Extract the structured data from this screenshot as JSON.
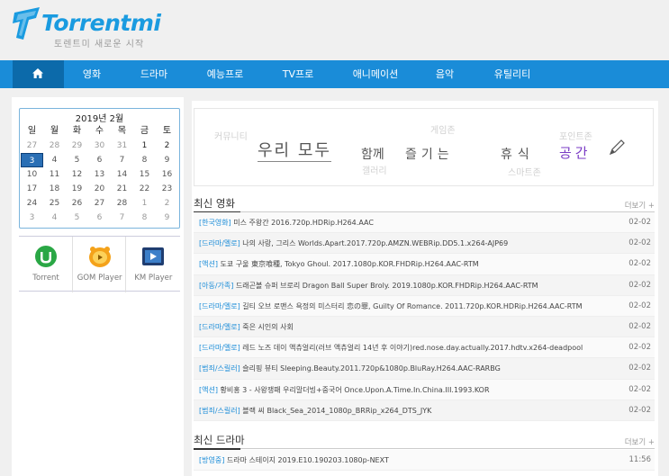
{
  "site": {
    "name": "Torrentmi",
    "tagline": "토렌트미 새로운 시작"
  },
  "nav": {
    "items": [
      "영화",
      "드라마",
      "예능프로",
      "TV프로",
      "애니메이션",
      "음악",
      "유틸리티"
    ]
  },
  "calendar": {
    "title": "2019년 2월",
    "weekdays": [
      "일",
      "월",
      "화",
      "수",
      "목",
      "금",
      "토"
    ],
    "weeks": [
      [
        "27",
        "28",
        "29",
        "30",
        "31",
        "1",
        "2"
      ],
      [
        "3",
        "4",
        "5",
        "6",
        "7",
        "8",
        "9"
      ],
      [
        "10",
        "11",
        "12",
        "13",
        "14",
        "15",
        "16"
      ],
      [
        "17",
        "18",
        "19",
        "20",
        "21",
        "22",
        "23"
      ],
      [
        "24",
        "25",
        "26",
        "27",
        "28",
        "1",
        "2"
      ],
      [
        "3",
        "4",
        "5",
        "6",
        "7",
        "8",
        "9"
      ]
    ],
    "today": "3"
  },
  "apps": [
    {
      "label": "Torrent"
    },
    {
      "label": "GOM Player"
    },
    {
      "label": "KM Player"
    }
  ],
  "banner": {
    "words": [
      "커뮤니티",
      "우리 모두",
      "함께",
      "즐기는",
      "휴식",
      "공간",
      "게임존",
      "갤러리",
      "포인트존",
      "스마트존"
    ]
  },
  "movies": {
    "title": "최신 영화",
    "more": "더보기 +",
    "rows": [
      {
        "cat": "[한국영화]",
        "text": "미스 주왕간 2016.720p.HDRip.H264.AAC",
        "date": "02-02"
      },
      {
        "cat": "[드라마/멜로]",
        "text": "나의 사랑, 그리스 Worlds.Apart.2017.720p.AMZN.WEBRip.DD5.1.x264-AJP69",
        "date": "02-02"
      },
      {
        "cat": "[액션]",
        "text": "도쿄 구울 東京喰種, Tokyo Ghoul. 2017.1080p.KOR.FHDRip.H264.AAC-RTM",
        "date": "02-02"
      },
      {
        "cat": "[아동/가족]",
        "text": "드래곤볼 슈퍼 브로리 Dragon Ball Super Broly. 2019.1080p.KOR.FHDRip.H264.AAC-RTM",
        "date": "02-02"
      },
      {
        "cat": "[드라마/멜로]",
        "text": "길티 오브 로맨스 욕정의 미스터리 恋の罪, Guilty Of Romance. 2011.720p.KOR.HDRip.H264.AAC-RTM",
        "date": "02-02"
      },
      {
        "cat": "[드라마/멜로]",
        "text": "죽은 시인의 사회",
        "date": "02-02"
      },
      {
        "cat": "[드라마/멜로]",
        "text": "레드 노즈 데이 액츄얼리(러브 액츄얼리 14년 후 이야기)red.nose.day.actually.2017.hdtv.x264-deadpool",
        "date": "02-02"
      },
      {
        "cat": "[범죄/스릴러]",
        "text": "슬리핑 뷰티 Sleeping.Beauty.2011.720p&1080p.BluRay.H264.AAC-RARBG",
        "date": "02-02"
      },
      {
        "cat": "[액션]",
        "text": "황비홍 3 - 사왕쟁패 우리말더빙+중국어 Once.Upon.A.Time.In.China.III.1993.KOR",
        "date": "02-02"
      },
      {
        "cat": "[범죄/스릴러]",
        "text": "블랙 씨 Black_Sea_2014_1080p_BRRip_x264_DTS_JYK",
        "date": "02-02"
      }
    ]
  },
  "dramas": {
    "title": "최신 드라마",
    "more": "더보기 +",
    "rows": [
      {
        "cat": "[방영중]",
        "text": "드라마 스테이지 2019.E10.190203.1080p-NEXT",
        "date": "11:56"
      }
    ]
  }
}
